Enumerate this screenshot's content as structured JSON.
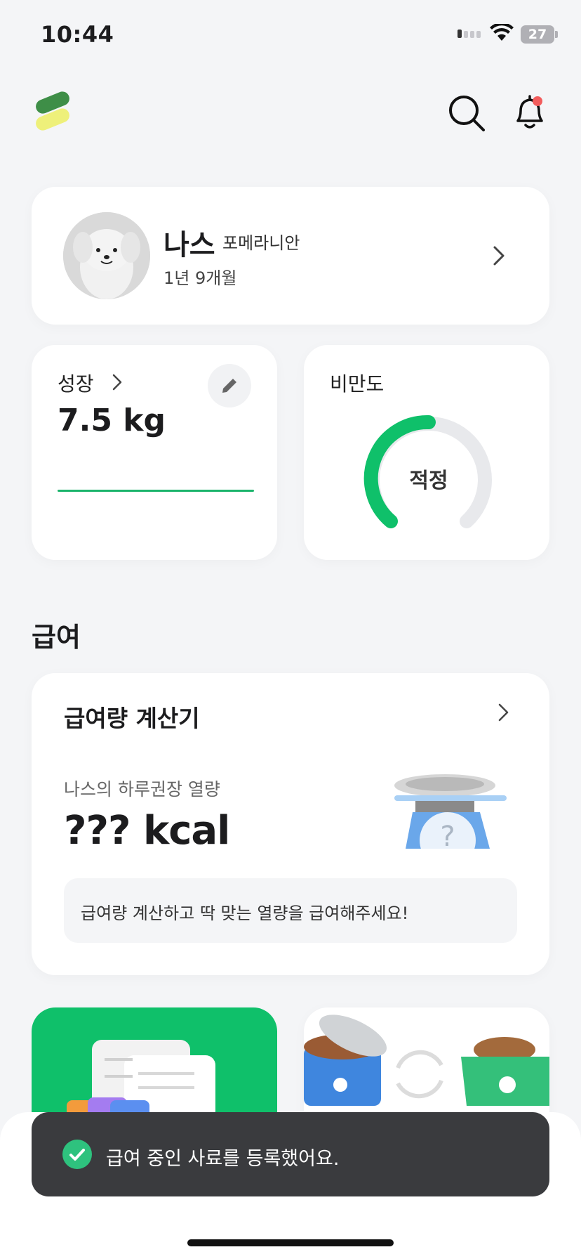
{
  "status_bar": {
    "time": "10:44",
    "battery": "27"
  },
  "profile": {
    "name": "나스",
    "breed": "포메라니안",
    "age": "1년 9개월"
  },
  "growth": {
    "title": "성장",
    "weight": "7.5 kg"
  },
  "obesity": {
    "title": "비만도",
    "status": "적정",
    "level_fraction": 0.5
  },
  "section": {
    "title": "급여"
  },
  "calculator": {
    "title": "급여량 계산기",
    "subtitle": "나스의 하루권장 열량",
    "value": "??? kcal",
    "hint": "급여량 계산하고 딱 맞는 열량을 급여해주세요!"
  },
  "toast": {
    "message": "급여 중인 사료를 등록했어요."
  },
  "colors": {
    "accent": "#1bb46c",
    "gauge": "#0fc06a",
    "toast_bg": "#3a3b3e",
    "badge": "#f25c5c"
  }
}
